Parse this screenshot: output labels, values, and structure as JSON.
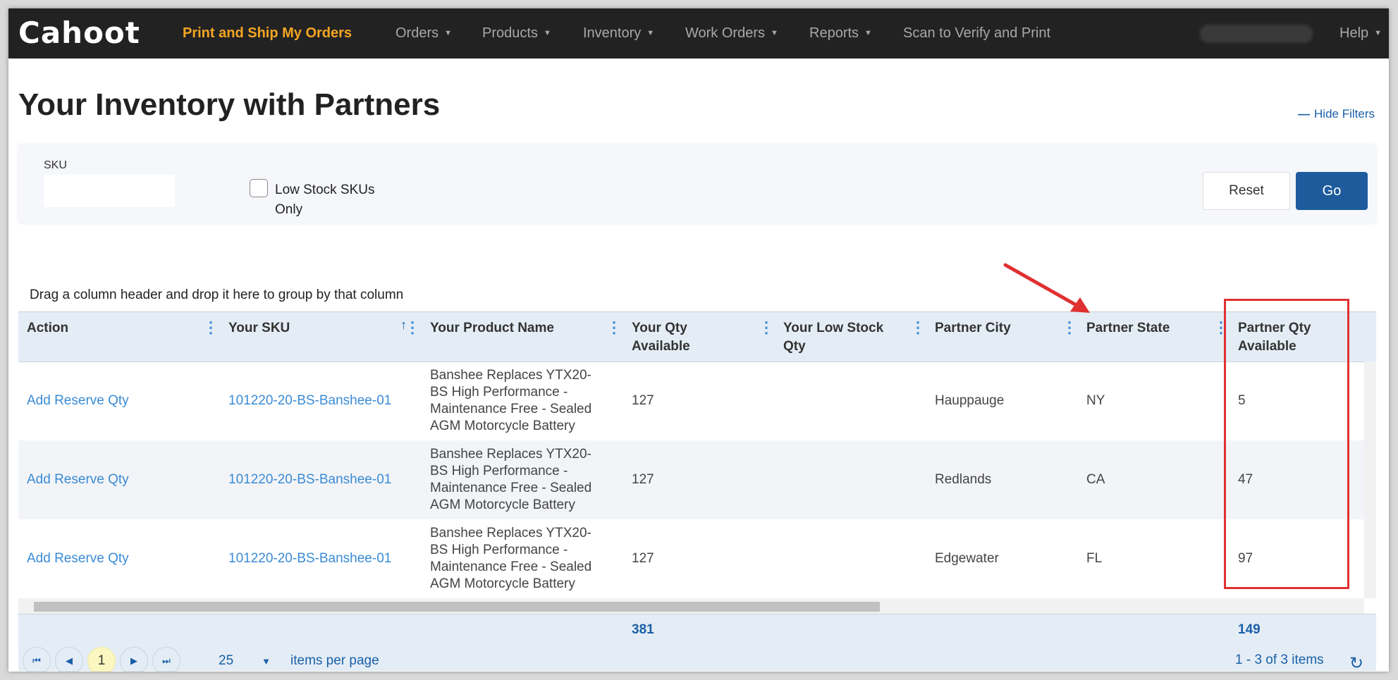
{
  "app": {
    "logo": "Cahoot"
  },
  "nav": {
    "items": [
      {
        "label": "Print and Ship My Orders",
        "active": true,
        "dropdown": false
      },
      {
        "label": "Orders",
        "dropdown": true
      },
      {
        "label": "Products",
        "dropdown": true
      },
      {
        "label": "Inventory",
        "dropdown": true
      },
      {
        "label": "Work Orders",
        "dropdown": true
      },
      {
        "label": "Reports",
        "dropdown": true
      },
      {
        "label": "Scan to Verify and Print",
        "dropdown": false
      }
    ],
    "help_label": "Help"
  },
  "page": {
    "title": "Your Inventory with Partners",
    "hide_filters_label": "Hide Filters"
  },
  "filters": {
    "sku_label": "SKU",
    "sku_value": "",
    "low_stock_label": "Low Stock SKUs Only",
    "low_stock_checked": false,
    "reset_label": "Reset",
    "go_label": "Go"
  },
  "grid": {
    "group_hint": "Drag a column header and drop it here to group by that column",
    "columns": [
      "Action",
      "Your SKU",
      "Your Product Name",
      "Your Qty Available",
      "Your Low Stock Qty",
      "Partner City",
      "Partner State",
      "Partner Qty Available"
    ],
    "rows": [
      {
        "action": "Add Reserve Qty",
        "sku": "101220-20-BS-Banshee-01",
        "name": "Banshee Replaces YTX20-BS High Performance - Maintenance Free - Sealed AGM Motorcycle Battery",
        "qty": "127",
        "low_stock": "",
        "city": "Hauppauge",
        "state": "NY",
        "partner_qty": "5"
      },
      {
        "action": "Add Reserve Qty",
        "sku": "101220-20-BS-Banshee-01",
        "name": "Banshee Replaces YTX20-BS High Performance - Maintenance Free - Sealed AGM Motorcycle Battery",
        "qty": "127",
        "low_stock": "",
        "city": "Redlands",
        "state": "CA",
        "partner_qty": "47"
      },
      {
        "action": "Add Reserve Qty",
        "sku": "101220-20-BS-Banshee-01",
        "name": "Banshee Replaces YTX20-BS High Performance - Maintenance Free - Sealed AGM Motorcycle Battery",
        "qty": "127",
        "low_stock": "",
        "city": "Edgewater",
        "state": "FL",
        "partner_qty": "97"
      }
    ],
    "totals": {
      "qty": "381",
      "partner_qty": "149"
    },
    "pager": {
      "current_page": "1",
      "page_size": "25",
      "per_page_label": "items per page",
      "info": "1 - 3 of 3 items"
    }
  },
  "colors": {
    "nav_bg": "#222222",
    "nav_active": "#f5a623",
    "primary": "#1d5b9c",
    "link": "#3a8bd6",
    "header_bg": "#e4edf5",
    "annotation": "#e03131"
  }
}
